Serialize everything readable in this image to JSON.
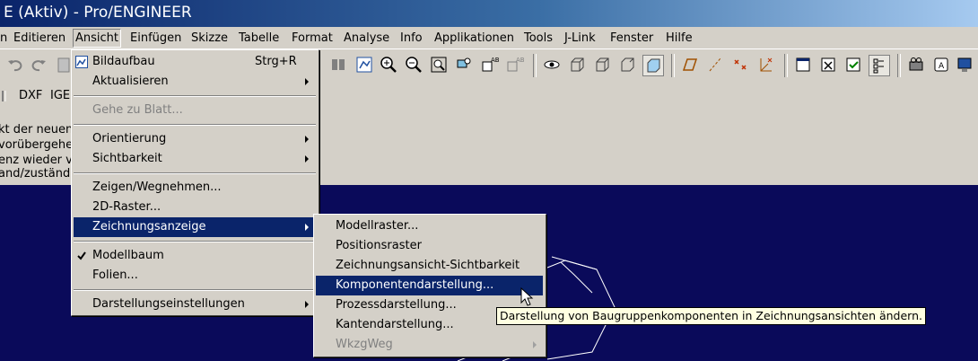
{
  "window": {
    "title": "E (Aktiv) - Pro/ENGINEER"
  },
  "menubar": {
    "items": [
      "n",
      "Editieren",
      "Ansicht",
      "Einfügen",
      "Skizze",
      "Tabelle",
      "Format",
      "Analyse",
      "Info",
      "Applikationen",
      "Tools",
      "J-Link",
      "Fenster",
      "Hilfe"
    ]
  },
  "toolbar2": {
    "dxf": "DXF",
    "ige": "IGE"
  },
  "message_area": {
    "lines": [
      "kt der neuen",
      "vorübergehe",
      "enz wieder v",
      "and/zuständ"
    ]
  },
  "ansicht_menu": {
    "items": [
      {
        "label": "Bildaufbau",
        "shortcut": "Strg+R",
        "icon": "repaint-icon"
      },
      {
        "label": "Aktualisieren",
        "submenu": true
      },
      {
        "label": "Gehe zu Blatt...",
        "disabled": true
      },
      {
        "label": "Orientierung",
        "submenu": true
      },
      {
        "label": "Sichtbarkeit",
        "submenu": true
      },
      {
        "label": "Zeigen/Wegnehmen..."
      },
      {
        "label": "2D-Raster..."
      },
      {
        "label": "Zeichnungsanzeige",
        "submenu": true,
        "selected": true
      },
      {
        "label": "Modellbaum",
        "checked": true
      },
      {
        "label": "Folien..."
      },
      {
        "label": "Darstellungseinstellungen",
        "submenu": true
      }
    ]
  },
  "zeichnungsanzeige_menu": {
    "items": [
      {
        "label": "Modellraster..."
      },
      {
        "label": "Positionsraster"
      },
      {
        "label": "Zeichnungsansicht-Sichtbarkeit"
      },
      {
        "label": "Komponentendarstellung...",
        "selected": true
      },
      {
        "label": "Prozessdarstellung..."
      },
      {
        "label": "Kantendarstellung..."
      },
      {
        "label": "WkzgWeg",
        "submenu": true,
        "disabled": true
      }
    ]
  },
  "tooltip": {
    "text": "Darstellung von Baugruppenkomponenten in Zeichnungsansichten ändern."
  },
  "colors": {
    "selection": "#0a246a",
    "graphics_bg": "#0a0a5a",
    "face": "#d4d0c8",
    "tooltip_bg": "#ffffe1"
  }
}
